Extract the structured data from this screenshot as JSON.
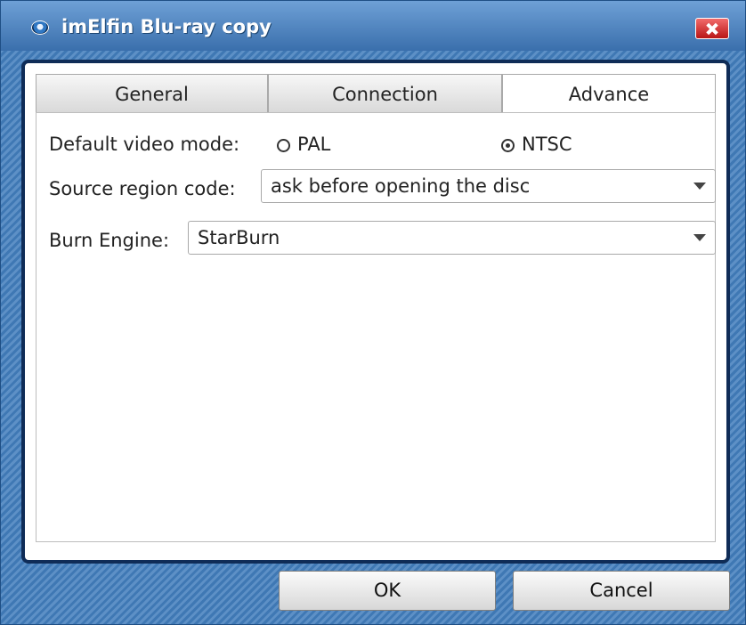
{
  "window": {
    "title": "imElfin Blu-ray copy",
    "accent_color": "#3f78b4",
    "close_icon": "close-icon"
  },
  "tabs": [
    {
      "label": "General",
      "active": false
    },
    {
      "label": "Connection",
      "active": false
    },
    {
      "label": "Advance",
      "active": true
    }
  ],
  "advance": {
    "video_mode": {
      "label": "Default video mode:",
      "options": [
        {
          "label": "PAL",
          "selected": false
        },
        {
          "label": "NTSC",
          "selected": true
        }
      ]
    },
    "region_code": {
      "label": "Source region code:",
      "value": "ask before opening the disc"
    },
    "burn_engine": {
      "label": "Burn Engine:",
      "value": "StarBurn"
    }
  },
  "buttons": {
    "ok": "OK",
    "cancel": "Cancel"
  }
}
